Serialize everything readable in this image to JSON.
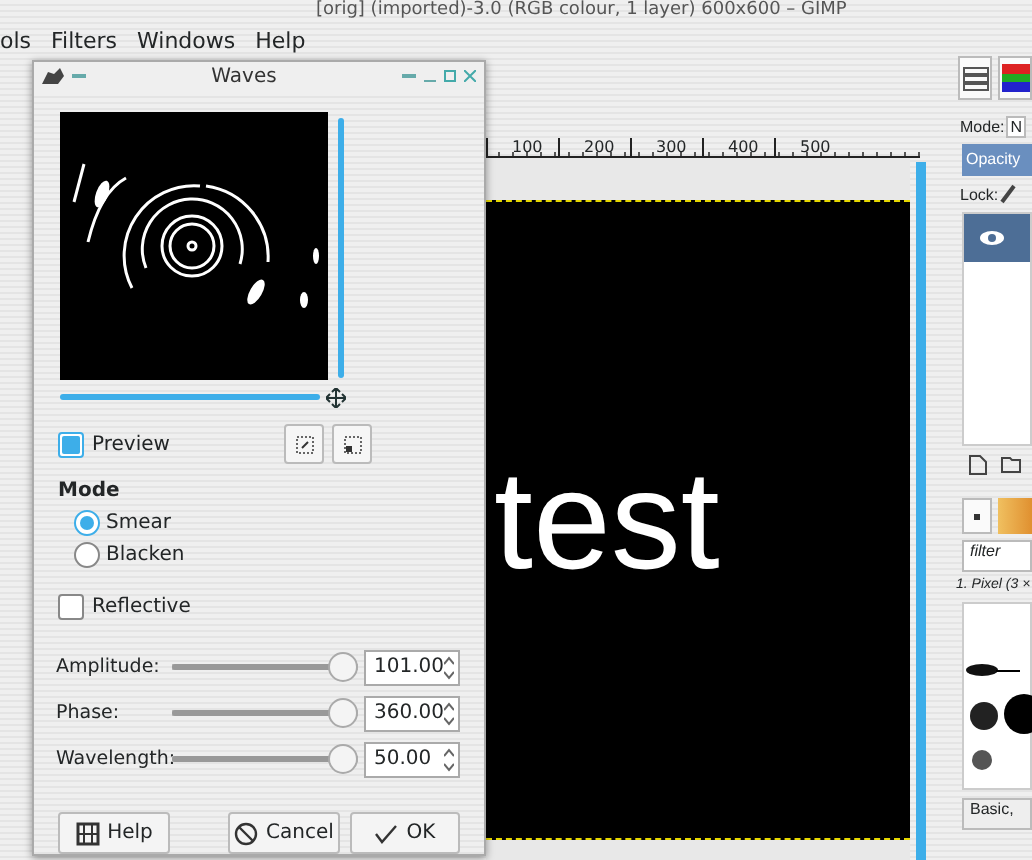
{
  "app": {
    "title": "[orig] (imported)-3.0 (RGB colour, 1 layer) 600x600 – GIMP",
    "menu": [
      "ols",
      "Filters",
      "Windows",
      "Help"
    ]
  },
  "ruler": [
    "100",
    "200",
    "300",
    "400",
    "500"
  ],
  "canvas": {
    "text": "test"
  },
  "dock": {
    "mode_label": "Mode:",
    "mode_value": "N",
    "opacity": {
      "label": "Opacity",
      "level": 1
    },
    "lock_label": "Lock:",
    "layer_visible": true,
    "brush_filter": "filter",
    "brush_name": "1. Pixel (3 ×",
    "brush_set": "Basic,"
  },
  "dialog": {
    "title": "Waves",
    "preview": {
      "label": "Preview",
      "checked": true
    },
    "mode": {
      "label": "Mode",
      "options": [
        {
          "label": "Smear",
          "selected": true
        },
        {
          "label": "Blacken",
          "selected": false
        }
      ]
    },
    "reflective": {
      "label": "Reflective",
      "checked": false
    },
    "sliders": [
      {
        "label": "Amplitude:",
        "level": 1,
        "value": "101.00"
      },
      {
        "label": "Phase:",
        "level": 1,
        "value": "360.00"
      },
      {
        "label": "Wavelength:",
        "level": 1,
        "value": "50.00"
      }
    ],
    "buttons": [
      {
        "kind": "help",
        "label": "Help"
      },
      {
        "kind": "cancel",
        "label": "Cancel"
      },
      {
        "kind": "ok",
        "label": "OK"
      }
    ]
  }
}
